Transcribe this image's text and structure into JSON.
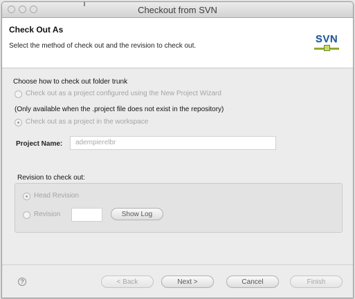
{
  "window": {
    "title": "Checkout from SVN"
  },
  "header": {
    "title": "Check Out As",
    "description": "Select the method of check out and the revision to check out.",
    "logo_text": "SVN"
  },
  "checkout": {
    "section_label": "Choose how to check out folder trunk",
    "option_wizard": "Check out as a project configured using the New Project Wizard",
    "note": "(Only available when the .project file does not exist in the repository)",
    "option_workspace": "Check out as a project in the workspace",
    "project_name_label": "Project Name:",
    "project_name_value": "adempierelbr"
  },
  "revision": {
    "group_label": "Revision to check out:",
    "head_label": "Head Revision",
    "revision_label": "Revision",
    "revision_value": "",
    "show_log": "Show Log"
  },
  "footer": {
    "help_symbol": "?",
    "back": "< Back",
    "next": "Next >",
    "cancel": "Cancel",
    "finish": "Finish"
  }
}
